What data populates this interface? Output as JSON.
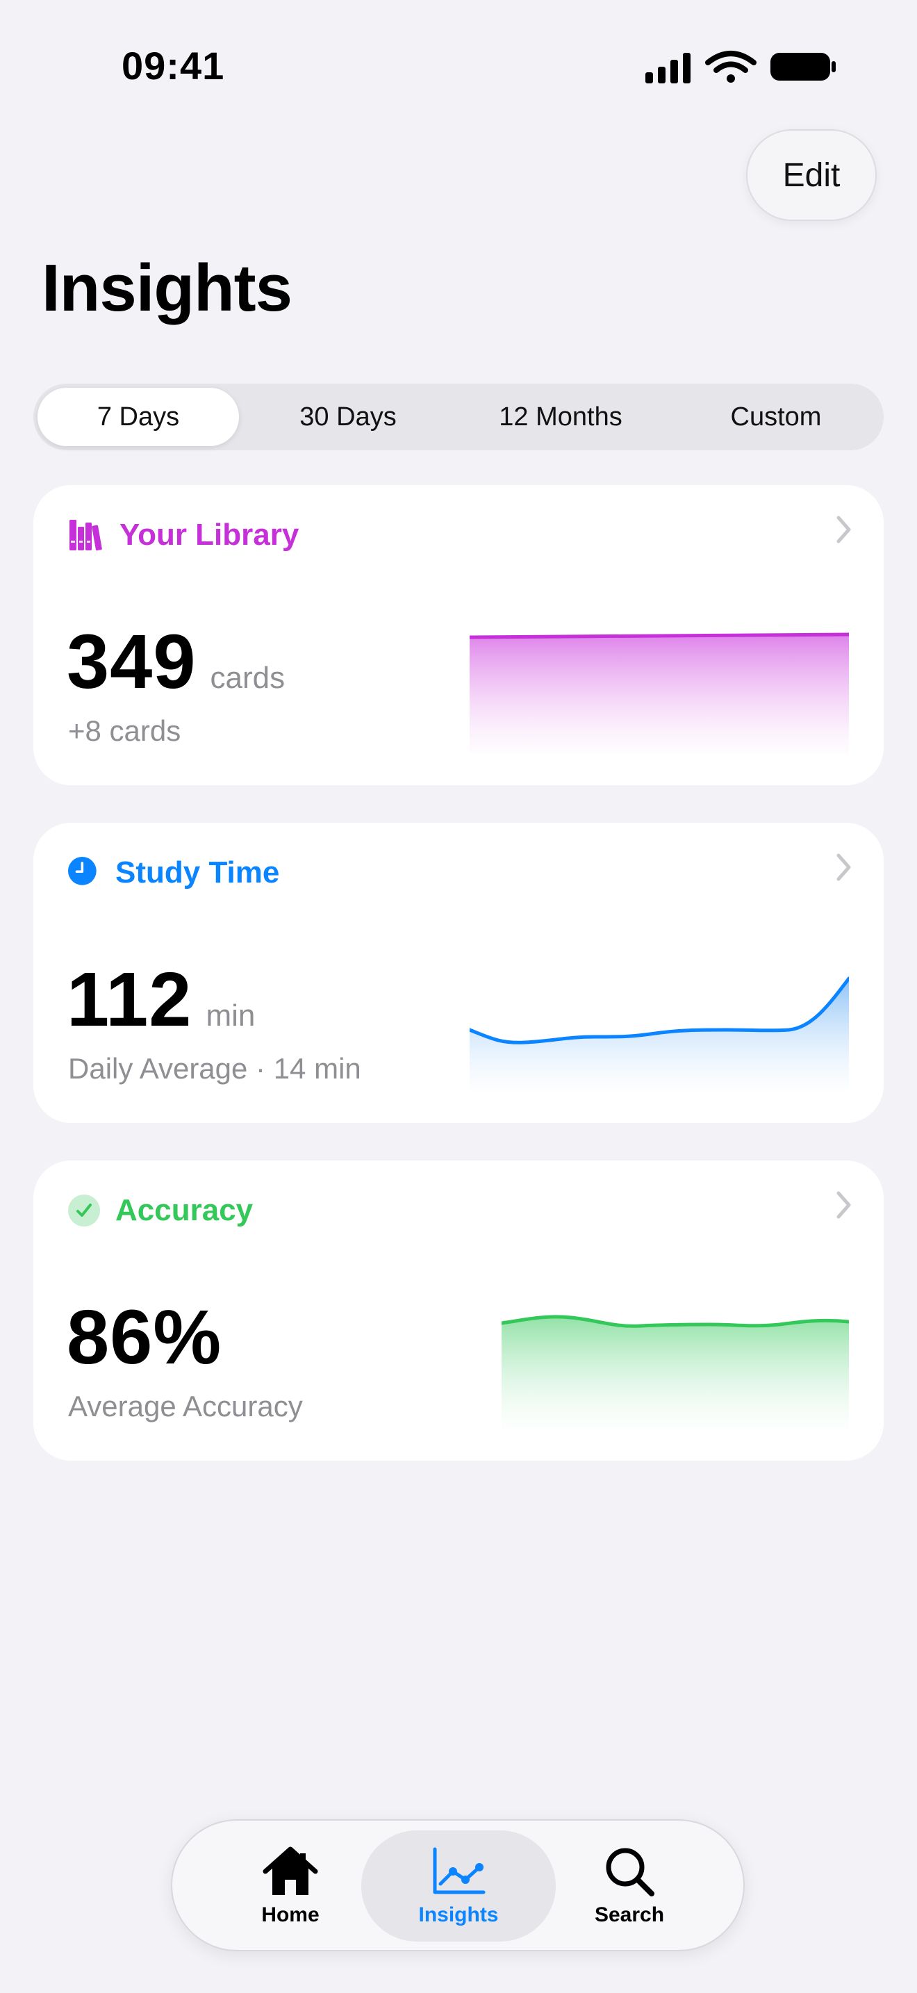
{
  "status_bar": {
    "time": "09:41"
  },
  "header": {
    "edit_label": "Edit",
    "title": "Insights"
  },
  "range_tabs": [
    {
      "label": "7 Days",
      "selected": true
    },
    {
      "label": "30 Days",
      "selected": false
    },
    {
      "label": "12 Months",
      "selected": false
    },
    {
      "label": "Custom",
      "selected": false
    }
  ],
  "cards": {
    "library": {
      "title": "Your Library",
      "icon": "books-icon",
      "color": "#c530d9",
      "value": "349",
      "unit": "cards",
      "subtitle": "+8 cards"
    },
    "study_time": {
      "title": "Study Time",
      "icon": "clock-icon",
      "color": "#0a84ff",
      "value": "112",
      "unit": "min",
      "subtitle": "Daily Average · 14 min"
    },
    "accuracy": {
      "title": "Accuracy",
      "icon": "checkmark-circle-icon",
      "color": "#34c759",
      "value": "86%",
      "subtitle": "Average Accuracy"
    }
  },
  "tab_bar": {
    "items": [
      {
        "label": "Home",
        "icon": "house-icon",
        "selected": false
      },
      {
        "label": "Insights",
        "icon": "chart-icon",
        "selected": true,
        "color": "#0a84ff"
      },
      {
        "label": "Search",
        "icon": "magnifying-glass-icon",
        "selected": false
      }
    ]
  }
}
